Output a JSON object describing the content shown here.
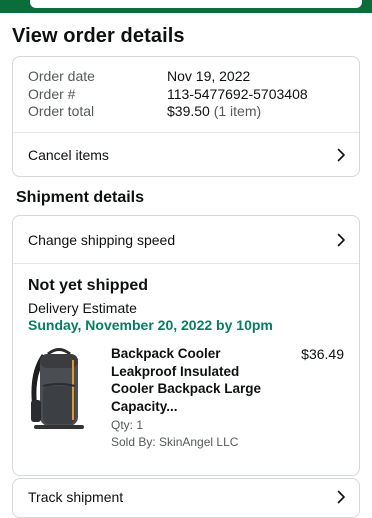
{
  "page": {
    "title": "View order details"
  },
  "order_summary": {
    "rows": [
      {
        "label": "Order date",
        "value": "Nov 19, 2022",
        "sub": ""
      },
      {
        "label": "Order #",
        "value": "113-5477692-5703408",
        "sub": ""
      },
      {
        "label": "Order total",
        "value": "$39.50",
        "sub": "(1 item)"
      }
    ],
    "cancel_label": "Cancel items"
  },
  "shipment": {
    "section_title": "Shipment details",
    "change_speed_label": "Change shipping speed",
    "status": "Not yet shipped",
    "estimate_label": "Delivery Estimate",
    "estimate_date": "Sunday, November 20, 2022 by 10pm",
    "product": {
      "title": "Backpack Cooler Leakproof Insulated Cooler Backpack Large Capacity...",
      "price": "$36.49",
      "qty": "Qty: 1",
      "seller": "Sold By: SkinAngel LLC",
      "image_icon": "backpack-cooler-image"
    },
    "track_label": "Track shipment"
  },
  "colors": {
    "header_green": "#0b6d3a",
    "estimate_green": "#067d62",
    "border": "#d5d9d9",
    "muted_text": "#565959"
  }
}
